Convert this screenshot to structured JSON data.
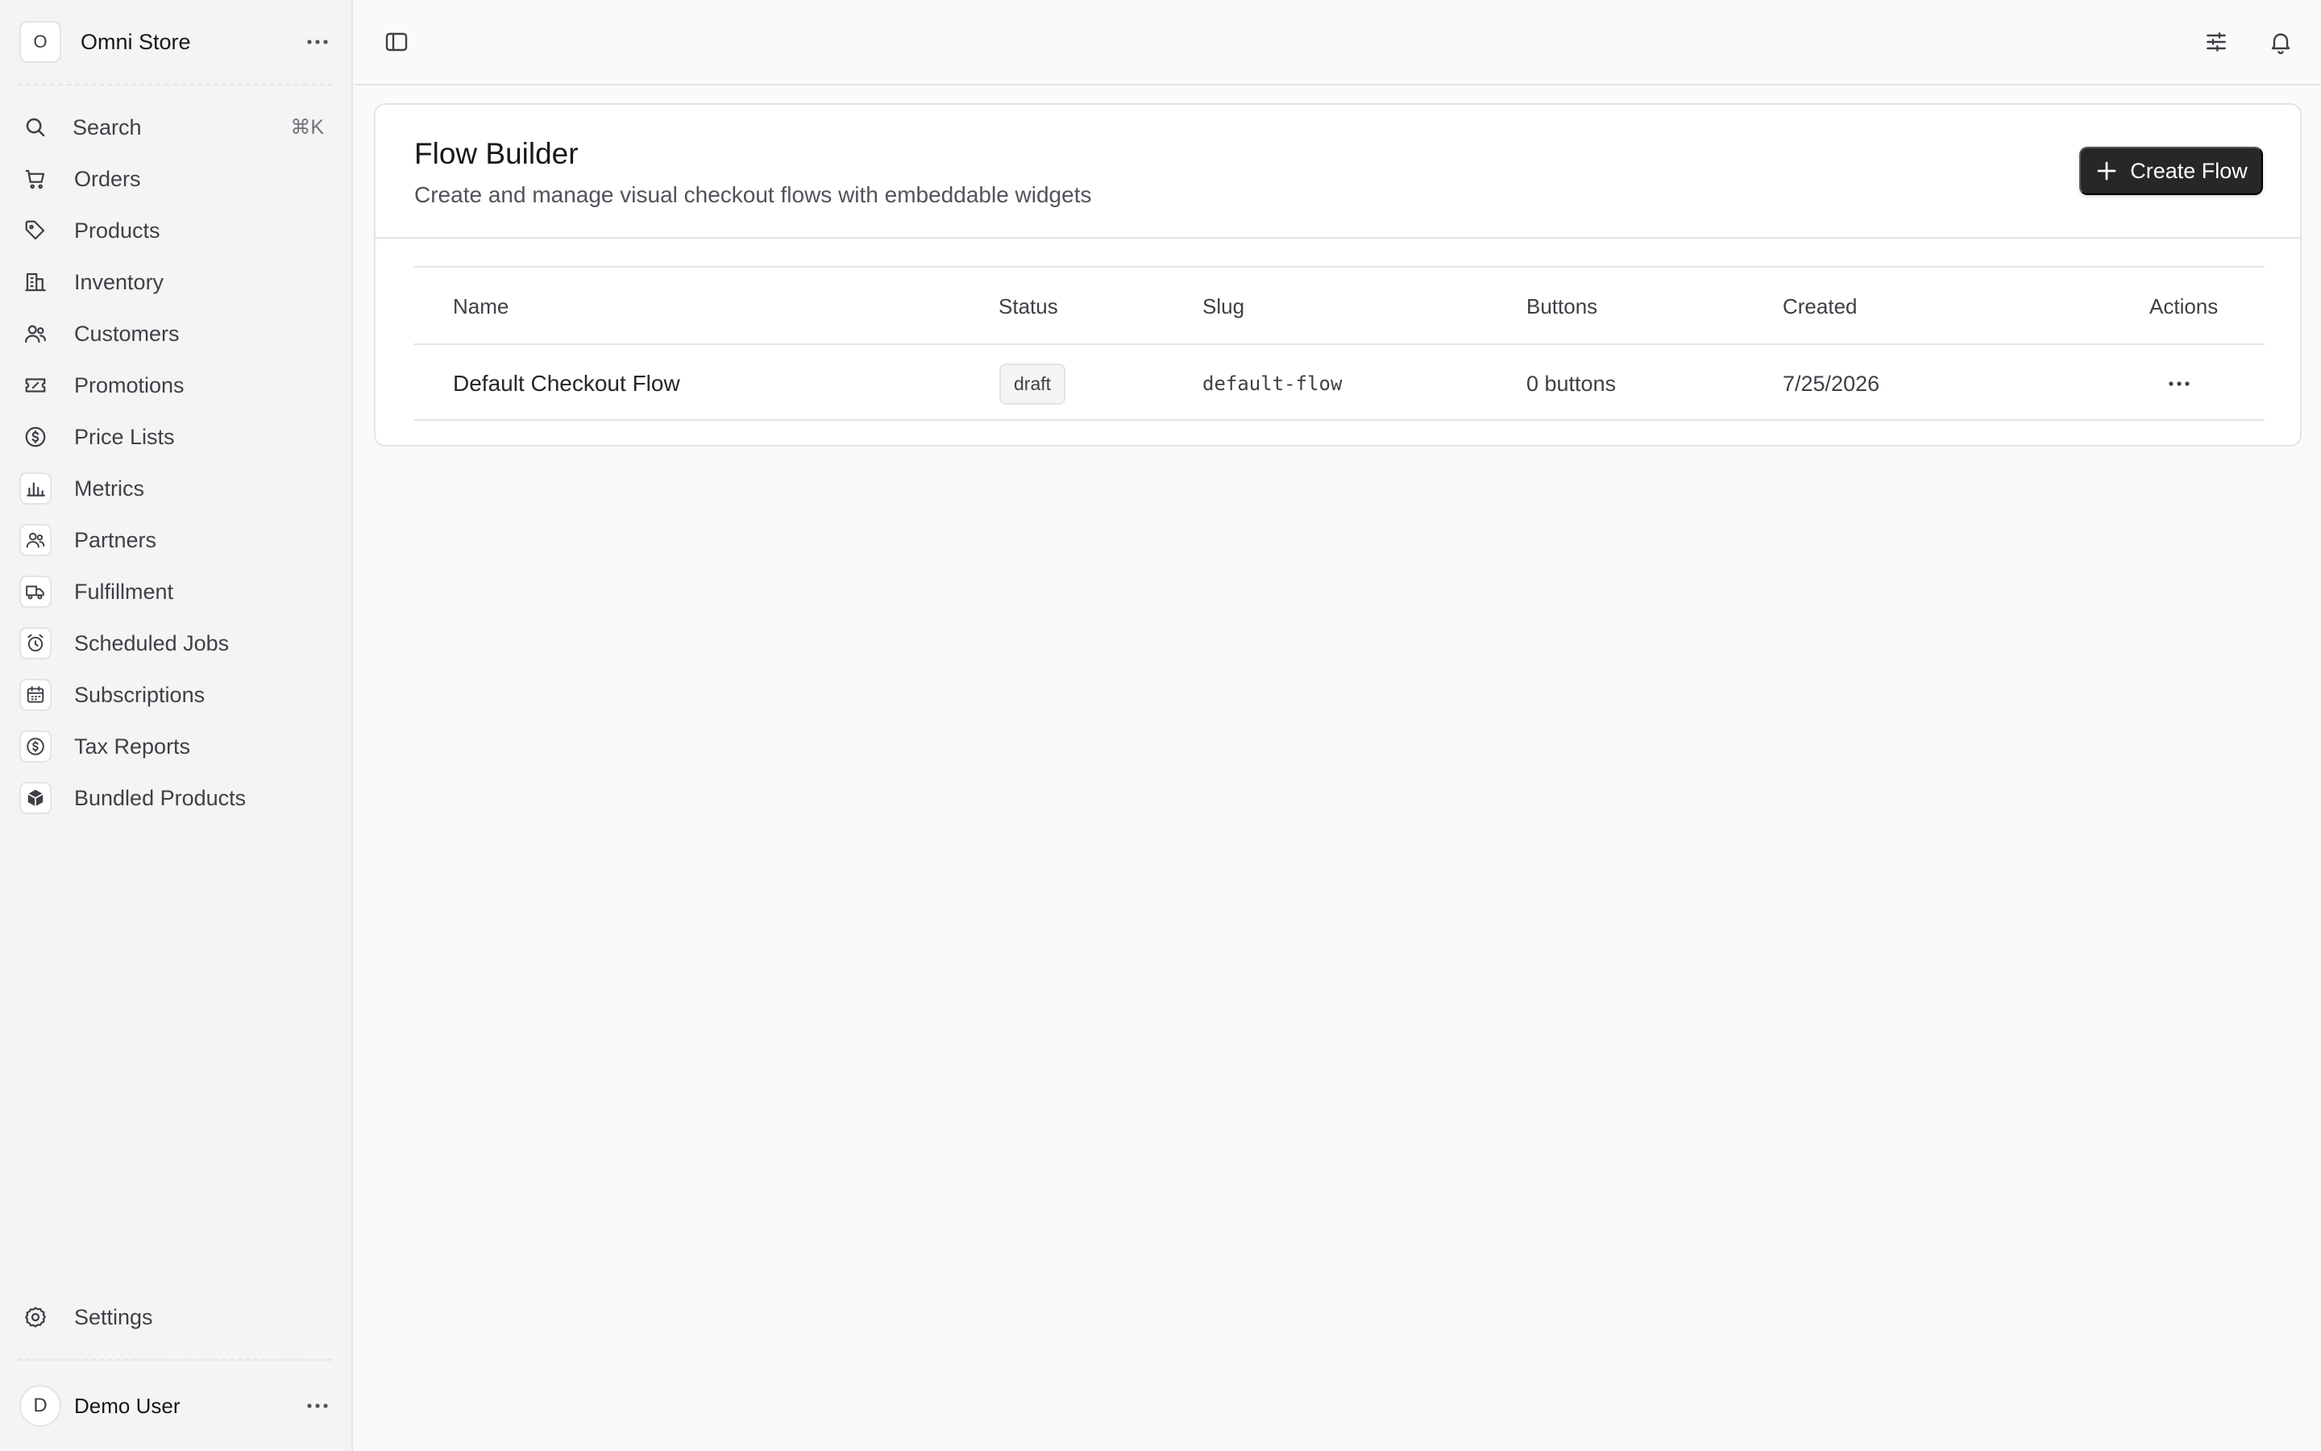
{
  "store": {
    "initial": "O",
    "name": "Omni Store"
  },
  "search": {
    "label": "Search",
    "shortcut": "⌘K"
  },
  "sidebar": {
    "items": [
      {
        "label": "Orders",
        "icon": "cart-icon"
      },
      {
        "label": "Products",
        "icon": "tag-icon"
      },
      {
        "label": "Inventory",
        "icon": "building-icon"
      },
      {
        "label": "Customers",
        "icon": "users-icon"
      },
      {
        "label": "Promotions",
        "icon": "ticket-icon"
      },
      {
        "label": "Price Lists",
        "icon": "currency-circle-icon"
      },
      {
        "label": "Metrics",
        "icon": "bar-chart-icon"
      },
      {
        "label": "Partners",
        "icon": "users-icon"
      },
      {
        "label": "Fulfillment",
        "icon": "truck-icon"
      },
      {
        "label": "Scheduled Jobs",
        "icon": "alarm-clock-icon"
      },
      {
        "label": "Subscriptions",
        "icon": "calendar-icon"
      },
      {
        "label": "Tax Reports",
        "icon": "currency-circle-icon"
      },
      {
        "label": "Bundled Products",
        "icon": "cube-icon"
      }
    ],
    "settings_label": "Settings"
  },
  "user": {
    "initial": "D",
    "name": "Demo User"
  },
  "page": {
    "title": "Flow Builder",
    "subtitle": "Create and manage visual checkout flows with embeddable widgets",
    "create_label": "Create Flow"
  },
  "table": {
    "headers": [
      "Name",
      "Status",
      "Slug",
      "Buttons",
      "Created",
      "Actions"
    ],
    "rows": [
      {
        "name": "Default Checkout Flow",
        "status": "draft",
        "slug": "default-flow",
        "buttons": "0 buttons",
        "created": "7/25/2026"
      }
    ]
  }
}
